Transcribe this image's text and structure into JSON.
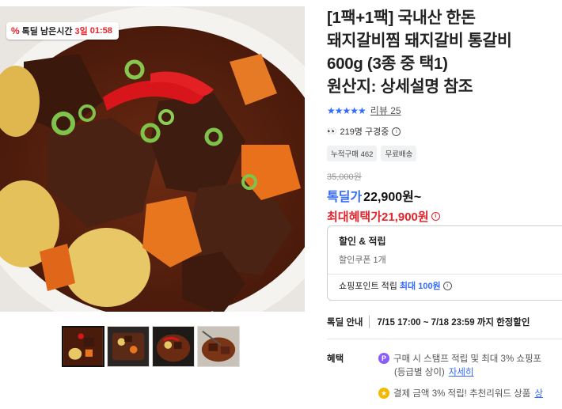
{
  "deal_timer": {
    "label": "톡딜 남은시간",
    "days": "3일",
    "time": "01:58"
  },
  "product": {
    "title": "[1팩+1팩] 국내산 한돈\n돼지갈비찜 돼지갈비 통갈비\n600g (3종 중 택1)\n원산지: 상세설명 참조",
    "rating": 5,
    "review_label": "리뷰 25",
    "viewers": "219명 구경중",
    "badges": [
      "누적구매 462",
      "무료배송"
    ],
    "original_price": "35,000원",
    "deal_label": "톡딜가",
    "deal_price": "22,900원~",
    "max_label": "최대혜택가",
    "max_price": "21,900원"
  },
  "benefit_box": {
    "title": "할인 & 적립",
    "coupon": "할인쿠폰 1개",
    "points_label": "쇼핑포인트 적립",
    "points_value": "최대 100원"
  },
  "deal_info": {
    "label": "톡딜 안내",
    "period": "7/15 17:00 ~ 7/18 23:59 까지 한정할인"
  },
  "benefits": {
    "label": "혜택",
    "line1": "구매 시 스탬프 적립 및 최대 3% 쇼핑포",
    "line1b": "(등급별 상이)",
    "detail_link": "자세히",
    "line2": "결제 금액 3% 적립! 추천리워드 상품",
    "line2_link": "상"
  },
  "colors": {
    "accent": "#346aff",
    "sale": "#e5232a"
  }
}
